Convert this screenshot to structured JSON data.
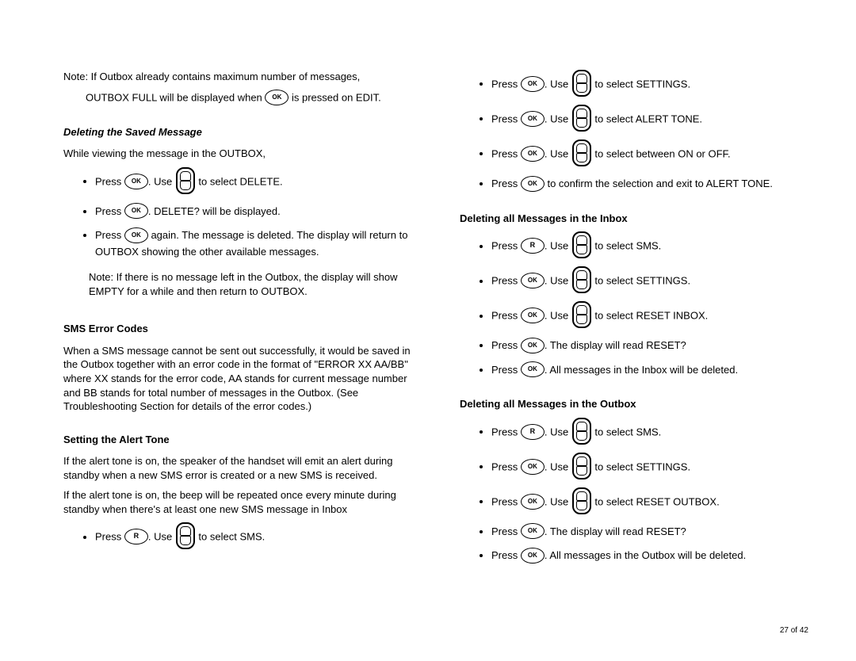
{
  "left": {
    "note1_line1": "Note:  If Outbox already contains maximum number of messages,",
    "note1_line2a": "OUTBOX FULL will be displayed when ",
    "note1_line2b": " is pressed on EDIT.",
    "h1": "Deleting the Saved Message",
    "p1": "While viewing the message in the OUTBOX,",
    "b1a": "Press ",
    "b1b": ". Use ",
    "b1c": " to select DELETE.",
    "b2a": "Press ",
    "b2b": ". DELETE? will be displayed.",
    "b3a": "Press ",
    "b3b": " again. The message is deleted. The display will return to OUTBOX showing the other available messages.",
    "note2": "Note: If there is no message left in the Outbox, the display will show EMPTY for a while and then return to OUTBOX.",
    "h2": "SMS Error Codes",
    "p2": "When a SMS message cannot be sent out successfully, it would be saved in the Outbox together with an error code in the format of \"ERROR XX   AA/BB\" where XX stands for the error code, AA stands for current message number and BB stands for total number of messages in the Outbox. (See Troubleshooting Section for details of the error codes.)",
    "h3": "Setting the Alert Tone",
    "p3": "If the alert tone is on, the speaker of the handset will emit an alert during standby when a new SMS error is created or a new SMS is received.",
    "p4": "If the alert tone is on, the beep will be repeated once every minute during standby when there's at least one new SMS message in Inbox",
    "b4a": "Press ",
    "b4b": ". Use ",
    "b4c": " to select SMS."
  },
  "right": {
    "b1a": "Press ",
    "b1b": ". Use ",
    "b1c": " to select SETTINGS.",
    "b2a": "Press ",
    "b2b": ". Use ",
    "b2c": " to select ALERT TONE.",
    "b3a": "Press ",
    "b3b": ". Use ",
    "b3c": " to select between ON or OFF.",
    "b4a": "Press ",
    "b4b": " to confirm the selection and exit to ALERT TONE.",
    "h1": "Deleting all Messages in the Inbox",
    "c1a": "Press ",
    "c1b": ". Use ",
    "c1c": " to select SMS.",
    "c2a": "Press ",
    "c2b": ". Use ",
    "c2c": " to select SETTINGS.",
    "c3a": "Press ",
    "c3b": ". Use ",
    "c3c": " to select RESET INBOX.",
    "c4a": "Press ",
    "c4b": ". The display will read RESET?",
    "c5a": "Press ",
    "c5b": ". All messages in the Inbox will be deleted.",
    "h2": "Deleting all Messages in the Outbox",
    "d1a": "Press ",
    "d1b": ". Use ",
    "d1c": " to select SMS.",
    "d2a": "Press ",
    "d2b": ". Use ",
    "d2c": " to select SETTINGS.",
    "d3a": "Press ",
    "d3b": ". Use ",
    "d3c": " to select RESET OUTBOX.",
    "d4a": "Press ",
    "d4b": ". The display will read RESET?",
    "d5a": "Press ",
    "d5b": ". All messages in the Outbox will be deleted."
  },
  "pagenum": "27 of 42",
  "ok_label": "OK",
  "r_label": "R"
}
